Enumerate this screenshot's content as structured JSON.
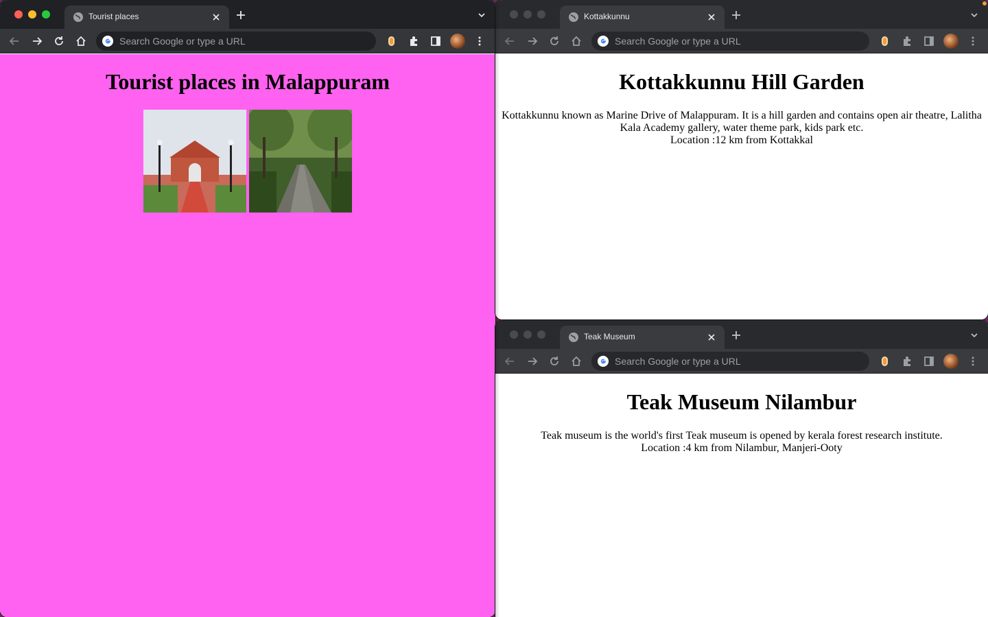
{
  "windows": {
    "main": {
      "tab_title": "Tourist places",
      "omnibox_placeholder": "Search Google or type a URL",
      "page": {
        "heading": "Tourist places in Malappuram",
        "background": "#ff61f0",
        "images": [
          "Kottakkunnu arch gate photo",
          "Tree-lined road photo"
        ]
      }
    },
    "top": {
      "tab_title": "Kottakkunnu",
      "omnibox_placeholder": "Search Google or type a URL",
      "page": {
        "heading": "Kottakkunnu Hill Garden",
        "description": "Kottakkunnu known as Marine Drive of Malappuram. It is a hill garden and contains open air theatre, Lalitha Kala Academy gallery, water theme park, kids park etc.",
        "location": "Location :12 km from Kottakkal"
      }
    },
    "bottom": {
      "tab_title": "Teak Museum",
      "omnibox_placeholder": "Search Google or type a URL",
      "page": {
        "heading": "Teak Museum Nilambur",
        "description": "Teak museum is the world's first Teak museum is opened by kerala forest research institute.",
        "location": "Location :4 km from Nilambur, Manjeri-Ooty"
      }
    }
  },
  "colors": {
    "tab_bg": "#35363a",
    "titlebar_bg": "#202124",
    "accent_orange": "#f29c38"
  },
  "icons": [
    "globe-icon",
    "close-icon",
    "plus-icon",
    "chevron-down-icon",
    "back-icon",
    "forward-icon",
    "reload-icon",
    "home-icon",
    "google-icon",
    "extension-icon",
    "puzzle-icon",
    "side-panel-icon",
    "avatar",
    "more-icon"
  ]
}
